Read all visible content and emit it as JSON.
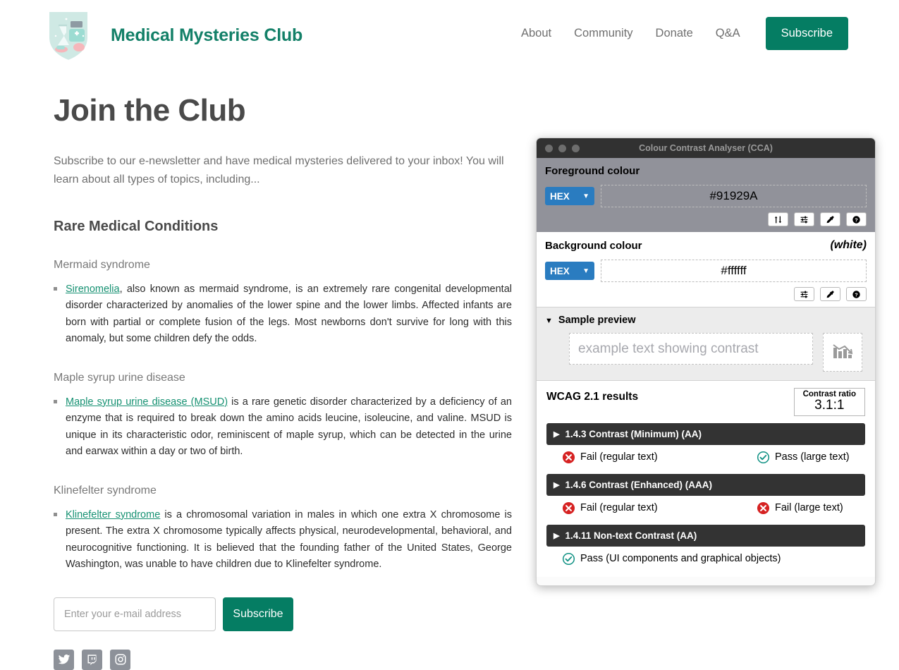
{
  "header": {
    "logo_icon": "medical-shield-logo",
    "brand": "Medical Mysteries Club",
    "nav": [
      {
        "label": "About"
      },
      {
        "label": "Community"
      },
      {
        "label": "Donate"
      },
      {
        "label": "Q&A"
      }
    ],
    "subscribe_label": "Subscribe",
    "accent_color": "#057d63",
    "brand_color": "#138068"
  },
  "main": {
    "page_title": "Join the Club",
    "intro": "Subscribe to our e-newsletter and have medical mysteries delivered to your inbox! You will learn about all types of topics, including...",
    "section_heading": "Rare Medical Conditions",
    "conditions": [
      {
        "heading": "Mermaid syndrome",
        "link_text": "Sirenomelia",
        "body": ", also known as mermaid syndrome, is an extremely rare congenital developmental disorder characterized by anomalies of the lower spine and the lower limbs. Affected infants are born with partial or complete fusion of the legs. Most newborns don't survive for long with this anomaly, but some children defy the odds."
      },
      {
        "heading": "Maple syrup urine disease",
        "link_text": "Maple syrup urine disease (MSUD)",
        "body": " is a rare genetic disorder characterized by a deficiency of an enzyme that is required to break down the amino acids leucine, isoleucine, and valine. MSUD is unique in its characteristic odor, reminiscent of maple syrup, which can be detected in the urine and earwax within a day or two of birth."
      },
      {
        "heading": "Klinefelter syndrome",
        "link_text": "Klinefelter syndrome",
        "body": " is a chromosomal variation in males in which one extra X chromosome is present. The extra X chromosome typically affects physical, neurodevelopmental, behavioral, and neurocognitive functioning. It is believed that the founding father of the United States, George Washington, was unable to have children due to Klinefelter syndrome."
      }
    ],
    "link_color": "#169172"
  },
  "signup": {
    "email_placeholder": "Enter your e-mail address",
    "email_value": "",
    "subscribe_label": "Subscribe"
  },
  "socials": [
    {
      "name": "twitter-icon"
    },
    {
      "name": "twitch-icon"
    },
    {
      "name": "instagram-icon"
    }
  ],
  "cca": {
    "window_title": "Colour Contrast Analyser (CCA)",
    "foreground": {
      "label": "Foreground colour",
      "format": "HEX",
      "value": "#91929A",
      "swatch_color": "#91929a",
      "buttons": [
        "swap-colours-icon",
        "sliders-icon",
        "eyedropper-icon",
        "help-icon"
      ]
    },
    "background": {
      "label": "Background colour",
      "note": "(white)",
      "format": "HEX",
      "value": "#ffffff",
      "buttons": [
        "sliders-icon",
        "eyedropper-icon",
        "help-icon"
      ]
    },
    "preview": {
      "label": "Sample preview",
      "expanded": true,
      "sample_text": "example text showing contrast",
      "graphic_icon": "declining-bar-chart-icon"
    },
    "results": {
      "title": "WCAG 2.1 results",
      "ratio_label": "Contrast ratio",
      "ratio_value": "3.1:1",
      "criteria": [
        {
          "name": "1.4.3 Contrast (Minimum) (AA)",
          "expanded": false,
          "outcomes": [
            {
              "status": "fail",
              "text": "Fail (regular text)"
            },
            {
              "status": "pass",
              "text": "Pass (large text)"
            }
          ]
        },
        {
          "name": "1.4.6 Contrast (Enhanced) (AAA)",
          "expanded": false,
          "outcomes": [
            {
              "status": "fail",
              "text": "Fail (regular text)"
            },
            {
              "status": "fail",
              "text": "Fail (large text)"
            }
          ]
        },
        {
          "name": "1.4.11 Non-text Contrast (AA)",
          "expanded": false,
          "outcomes": [
            {
              "status": "pass",
              "text": "Pass (UI components and graphical objects)"
            }
          ]
        }
      ],
      "pass_color": "#0f9183",
      "fail_color": "#d62222"
    }
  }
}
